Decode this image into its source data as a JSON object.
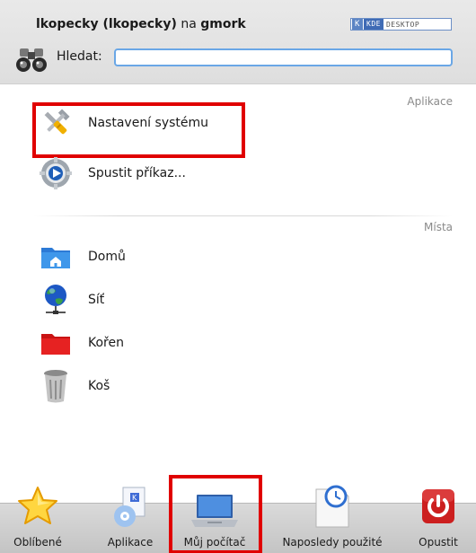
{
  "header": {
    "user_name": "lkopecky (lkopecky)",
    "host_prefix": "na",
    "host_name": "gmork",
    "kde_logo_k": "K",
    "kde_logo_kde": "KDE",
    "kde_logo_desktop": "DESKTOP"
  },
  "search": {
    "label": "Hledat:",
    "value": "",
    "placeholder": ""
  },
  "sections": {
    "apps_title": "Aplikace",
    "places_title": "Místa"
  },
  "apps": [
    {
      "label": "Nastavení systému",
      "icon": "system-settings-icon"
    },
    {
      "label": "Spustit příkaz...",
      "icon": "run-command-icon"
    }
  ],
  "places": [
    {
      "label": "Domů",
      "icon": "home-folder-icon"
    },
    {
      "label": "Síť",
      "icon": "network-globe-icon"
    },
    {
      "label": "Kořen",
      "icon": "root-folder-icon"
    },
    {
      "label": "Koš",
      "icon": "trash-icon"
    }
  ],
  "tabs": [
    {
      "label": "Oblíbené",
      "icon": "star-icon"
    },
    {
      "label": "Aplikace",
      "icon": "applications-icon"
    },
    {
      "label": "Můj počítač",
      "icon": "laptop-icon",
      "active": true
    },
    {
      "label": "Naposledy použité",
      "icon": "recent-clock-icon"
    },
    {
      "label": "Opustit",
      "icon": "power-icon"
    }
  ],
  "colors": {
    "highlight": "#e00000",
    "search_border": "#6aa7e6",
    "folder_blue": "#3b8ee0",
    "folder_red": "#e02020",
    "power_red": "#cc1f1f"
  }
}
